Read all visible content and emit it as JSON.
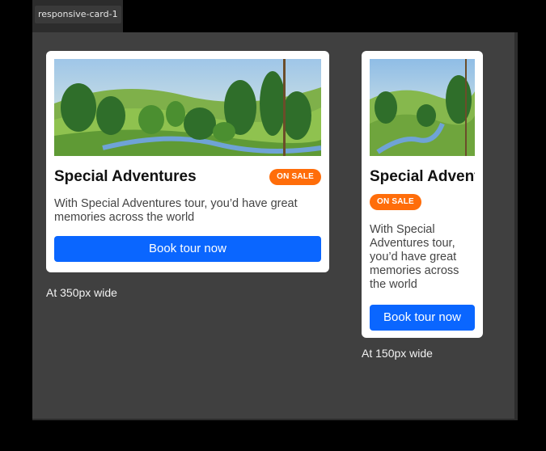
{
  "frame": {
    "label": "responsive-card-1"
  },
  "cards": [
    {
      "title": "Special Adventures",
      "badge": "ON SALE",
      "description": "With Special Adventures tour, you’d have great memories across the world",
      "button": "Book tour now",
      "image_icon": "landscape-image",
      "caption": "At 350px wide"
    },
    {
      "title": "Special Advent",
      "badge": "ON SALE",
      "description": "With Special Adventures tour, you’d have great memories across the world",
      "button": "Book tour now",
      "image_icon": "landscape-image",
      "caption": "At 150px wide"
    }
  ],
  "colors": {
    "badge": "#ff6d0a",
    "button": "#0a66ff",
    "frame_bg": "#404040",
    "page_bg": "#000000"
  }
}
